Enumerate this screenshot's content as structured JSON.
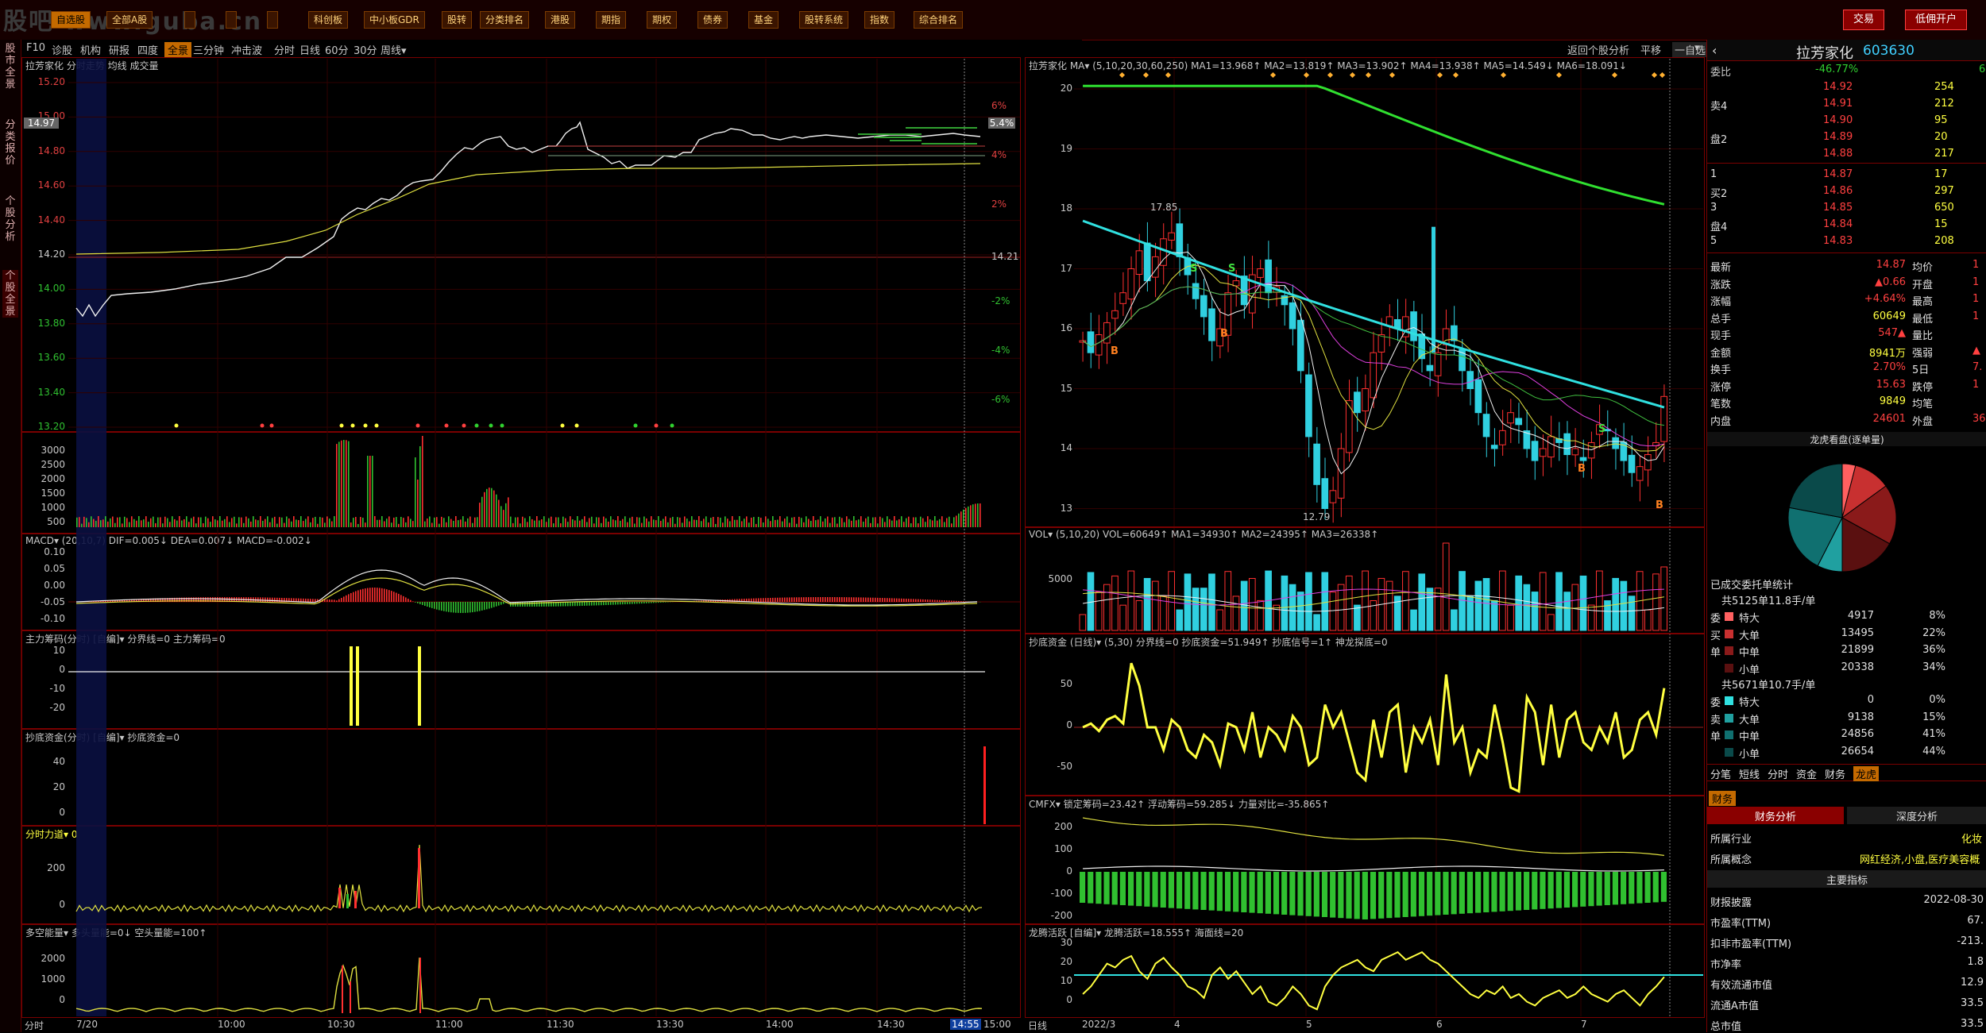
{
  "topbar": {
    "logo": "股吧 www.guba.cn",
    "menu": [
      "自选股",
      "全部A股",
      "",
      "",
      "",
      "科创板",
      "中小板GDR",
      "股转",
      "分类排名",
      "港股",
      "期指",
      "期权",
      "债券",
      "基金",
      "股转系统",
      "指数",
      "综合排名"
    ],
    "trade_btn": "交易",
    "margin_btn": "低佣开户"
  },
  "left_tabs": [
    "股市全景",
    "分类报价",
    "个股分析",
    "个股全景"
  ],
  "subbar": [
    "F10",
    "诊股",
    "机构",
    "研报",
    "四度",
    "全景",
    "三分钟",
    "冲击波",
    "分时",
    "日线",
    "60分",
    "30分",
    "周线▾"
  ],
  "subbar_right": [
    "返回个股分析",
    "平移",
    "一自选",
    "▾"
  ],
  "intraday": {
    "header": "拉芳家化  分时走势  均线  成交量",
    "price_labels": [
      "15.20",
      "15.00",
      "14.80",
      "14.60",
      "14.40",
      "14.20",
      "14.00",
      "13.80",
      "13.60",
      "13.40",
      "13.20"
    ],
    "pct_labels": [
      "6%",
      "4%",
      "2%",
      "-2%",
      "-4%",
      "-6%"
    ],
    "current_tag": "14.97",
    "pct_tag": "5.4%",
    "base_price": "14.21",
    "time_labels": [
      "7/20",
      "10:00",
      "10:30",
      "11:00",
      "11:30",
      "13:30",
      "14:00",
      "14:30",
      "14:55",
      "15:00"
    ],
    "footer_left": "分时",
    "vol_labels": [
      "3000",
      "2500",
      "2000",
      "1500",
      "1000",
      "500"
    ],
    "macd_header": "MACD▾ (20,10,7) DIF=0.005↓ DEA=0.007↓ MACD=-0.002↓",
    "macd_labels": [
      "0.10",
      "0.05",
      "0.00",
      "-0.05",
      "-0.10"
    ],
    "zl_header": "主力筹码(分时) [自编]▾  分界线=0 主力筹码=0",
    "zl_labels": [
      "10",
      "0",
      "-10",
      "-20"
    ],
    "cd_header": "抄底资金(分时) [自编]▾  抄底资金=0",
    "cd_labels": [
      "40",
      "20",
      "0"
    ],
    "fl_header": "分时力道▾  0",
    "fl_labels": [
      "200",
      "0"
    ],
    "dk_header": "多空能量▾  多头量能=0↓ 空头量能=100↑",
    "dk_labels": [
      "2000",
      "1000",
      "0"
    ]
  },
  "daily": {
    "header": "拉芳家化  MA▾ (5,10,20,30,60,250)  MA1=13.968↑ MA2=13.819↑ MA3=13.902↑ MA4=13.938↑ MA5=14.549↓ MA6=18.091↓",
    "price_labels": [
      "20",
      "19",
      "18",
      "17",
      "16",
      "15",
      "14",
      "13"
    ],
    "high_label": "17.85",
    "low_label": "12.79",
    "vol_header": "VOL▾ (5,10,20)  VOL=60649↑ MA1=34930↑ MA2=24395↑ MA3=26338↑",
    "vol_labels": [
      "5000"
    ],
    "cdzj_header": "抄底资金 (日线)▾ (5,30)  分界线=0  抄底资金=51.949↑ 抄底信号=1↑ 神龙探底=0",
    "cdzj_labels": [
      "50",
      "0",
      "-50"
    ],
    "cmfx_header": "CMFX▾  锁定筹码=23.42↑ 浮动筹码=59.285↓ 力量对比=-35.865↑",
    "cmfx_labels": [
      "200",
      "100",
      "0",
      "-100",
      "-200"
    ],
    "lt_header": "龙腾活跃 [自编]▾  龙腾活跃=18.555↑ 海面线=20",
    "lt_labels": [
      "30",
      "20",
      "10",
      "0"
    ],
    "time_labels": [
      "2022/3",
      "4",
      "5",
      "6",
      "7"
    ],
    "footer_left": "日线"
  },
  "quote": {
    "name": "拉芳家化",
    "code": "603630",
    "weibi_label": "委比",
    "weibi": "-46.77%",
    "weibi_r": "6",
    "asks": [
      {
        "label": "",
        "price": "14.92",
        "vol": "254"
      },
      {
        "label": "卖4",
        "price": "14.91",
        "vol": "212"
      },
      {
        "label": "",
        "price": "14.90",
        "vol": "95"
      },
      {
        "label": "盘2",
        "price": "14.89",
        "vol": "20"
      },
      {
        "label": "",
        "price": "14.88",
        "vol": "217"
      }
    ],
    "bids": [
      {
        "label": "1",
        "price": "14.87",
        "vol": "17"
      },
      {
        "label": "买2",
        "price": "14.86",
        "vol": "297"
      },
      {
        "label": "3",
        "price": "14.85",
        "vol": "650"
      },
      {
        "label": "盘4",
        "price": "14.84",
        "vol": "15"
      },
      {
        "label": "5",
        "price": "14.83",
        "vol": "208"
      }
    ],
    "stats": [
      {
        "k": "最新",
        "v": "14.87",
        "k2": "均价",
        "v2": "1"
      },
      {
        "k": "涨跌",
        "v": "▲0.66",
        "k2": "开盘",
        "v2": "1"
      },
      {
        "k": "涨幅",
        "v": "+4.64%",
        "k2": "最高",
        "v2": "1"
      },
      {
        "k": "总手",
        "v": "60649",
        "k2": "最低",
        "v2": "1"
      },
      {
        "k": "现手",
        "v": "547▲",
        "k2": "量比",
        "v2": ""
      },
      {
        "k": "金额",
        "v": "8941万",
        "k2": "强弱",
        "v2": "▲"
      },
      {
        "k": "换手",
        "v": "2.70%",
        "k2": "5日",
        "v2": "7."
      },
      {
        "k": "涨停",
        "v": "15.63",
        "k2": "跌停",
        "v2": "1"
      },
      {
        "k": "笔数",
        "v": "9849",
        "k2": "均笔",
        "v2": ""
      },
      {
        "k": "内盘",
        "v": "24601",
        "k2": "外盘",
        "v2": "36"
      }
    ],
    "pie_title": "龙虎看盘(逐单量)",
    "pie_slices": [
      {
        "name": "特大买",
        "value": 8,
        "color": "#ff6060"
      },
      {
        "name": "大单买",
        "value": 22,
        "color": "#c83030"
      },
      {
        "name": "中单买",
        "value": 36,
        "color": "#8a1a1a"
      },
      {
        "name": "小单买",
        "value": 34,
        "color": "#5a1010"
      },
      {
        "name": "大单卖",
        "value": 15,
        "color": "#20a0a0"
      },
      {
        "name": "中单卖",
        "value": 41,
        "color": "#107070"
      },
      {
        "name": "小单卖",
        "value": 44,
        "color": "#0a4a4a"
      }
    ],
    "deal_title": "已成交委托单统计",
    "buy_total": "共5125单11.8手/单",
    "buy_rows": [
      {
        "side": "委",
        "name": "特大",
        "vol": "4917",
        "pct": "8%",
        "color": "#ff6060"
      },
      {
        "side": "买",
        "name": "大单",
        "vol": "13495",
        "pct": "22%",
        "color": "#c83030"
      },
      {
        "side": "单",
        "name": "中单",
        "vol": "21899",
        "pct": "36%",
        "color": "#8a1a1a"
      },
      {
        "side": "",
        "name": "小单",
        "vol": "20338",
        "pct": "34%",
        "color": "#5a1010"
      }
    ],
    "sell_total": "共5671单10.7手/单",
    "sell_rows": [
      {
        "side": "委",
        "name": "特大",
        "vol": "0",
        "pct": "0%",
        "color": "#30e0e0"
      },
      {
        "side": "卖",
        "name": "大单",
        "vol": "9138",
        "pct": "15%",
        "color": "#20a0a0"
      },
      {
        "side": "单",
        "name": "中单",
        "vol": "24856",
        "pct": "41%",
        "color": "#107070"
      },
      {
        "side": "",
        "name": "小单",
        "vol": "26654",
        "pct": "44%",
        "color": "#0a4a4a"
      }
    ],
    "tabs": [
      "分笔",
      "短线",
      "分时",
      "资金",
      "财务",
      "龙虎"
    ],
    "fin_tab": "财务",
    "fin_sub1": "财务分析",
    "fin_sub2": "深度分析",
    "industry_k": "所属行业",
    "industry_v": "化妆",
    "concept_k": "所属概念",
    "concept_v": "网红经济,小盘,医疗美容概",
    "main_index": "主要指标",
    "fin_rows": [
      {
        "k": "财报披露",
        "v": "2022-08-30"
      },
      {
        "k": "市盈率(TTM)",
        "v": "67."
      },
      {
        "k": "扣非市盈率(TTM)",
        "v": "-213."
      },
      {
        "k": "市净率",
        "v": "1.8"
      },
      {
        "k": "有效流通市值",
        "v": "12.9"
      },
      {
        "k": "流通A市值",
        "v": "33.5"
      },
      {
        "k": "总市值",
        "v": "33.5"
      }
    ]
  }
}
